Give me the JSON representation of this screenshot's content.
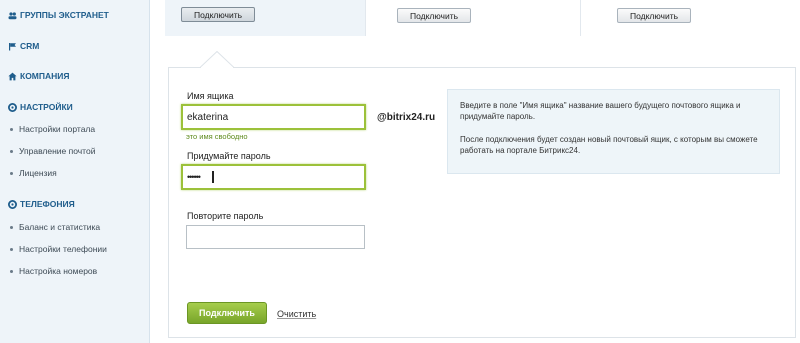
{
  "sidebar": {
    "sections": [
      {
        "label": "ГРУППЫ ЭКСТРАНЕТ",
        "icon": "people-icon"
      },
      {
        "label": "CRM",
        "icon": "flag-icon"
      },
      {
        "label": "КОМПАНИЯ",
        "icon": "home-icon"
      },
      {
        "label": "НАСТРОЙКИ",
        "icon": "settings-icon",
        "items": [
          "Настройки портала",
          "Управление почтой",
          "Лицензия"
        ]
      },
      {
        "label": "ТЕЛЕФОНИЯ",
        "icon": "phone-icon",
        "items": [
          "Баланс и статистика",
          "Настройки телефонии",
          "Настройка номеров"
        ]
      }
    ]
  },
  "top_buttons": [
    "Подключить",
    "Подключить",
    "Подключить"
  ],
  "form": {
    "mailbox_label": "Имя ящика",
    "mailbox_value": "ekaterina",
    "domain": "@bitrix24.ru",
    "mailbox_hint": "это имя свободно",
    "password_label": "Придумайте пароль",
    "password_value": "••••••",
    "repeat_label": "Повторите пароль",
    "repeat_value": "",
    "submit_label": "Подключить",
    "clear_label": "Очистить"
  },
  "info": {
    "paragraph1": "Введите в поле \"Имя ящика\" название вашего будущего почтового ящика и придумайте пароль.",
    "paragraph2": "После подключения будет создан новый почтовый ящик, с которым вы сможете работать на портале Битрикс24."
  },
  "colors": {
    "accent_green": "#8ab83a",
    "link_blue": "#1f5d8c",
    "sidebar_bg": "#eef4f9"
  }
}
